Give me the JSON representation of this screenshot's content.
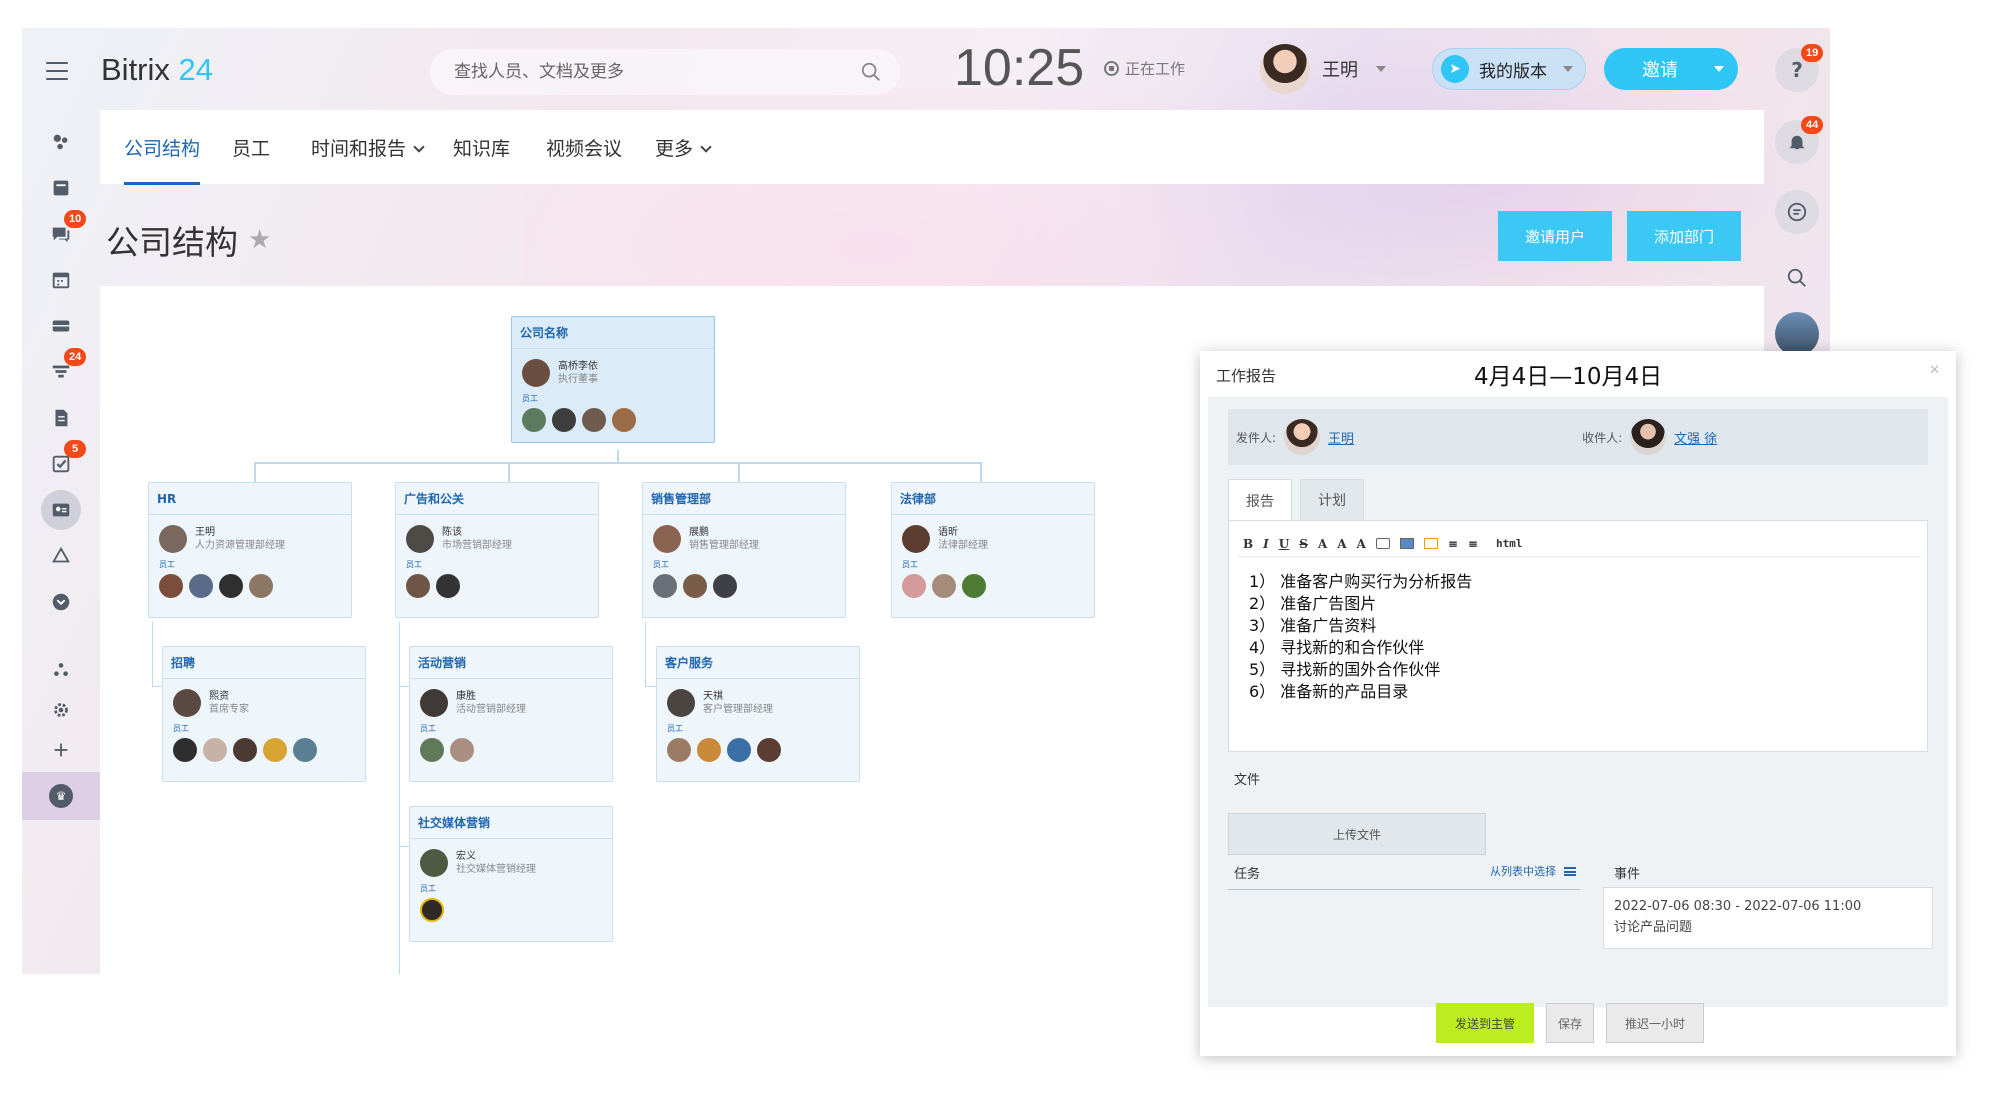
{
  "app": {
    "logo_text": "Bitrix",
    "logo_num": "24",
    "clock": "10:25",
    "work_status": "正在工作"
  },
  "search": {
    "placeholder": "查找人员、文档及更多"
  },
  "user": {
    "name": "王明"
  },
  "header": {
    "my_version": "我的版本",
    "invite": "邀请"
  },
  "right_bar": {
    "help_count": "19",
    "notify_count": "44"
  },
  "left_bar": {
    "chat_count": "10",
    "feed_count": "24",
    "tasks_count": "5"
  },
  "tabs": [
    {
      "label": "公司结构"
    },
    {
      "label": "员工"
    },
    {
      "label": "时间和报告"
    },
    {
      "label": "知识库"
    },
    {
      "label": "视频会议"
    },
    {
      "label": "更多"
    }
  ],
  "page": {
    "title": "公司结构",
    "invite_users": "邀请用户",
    "add_department": "添加部门"
  },
  "accent": "#2fc6f6",
  "org": {
    "employees_label": "员工",
    "root": {
      "name": "公司名称",
      "manager": "高桥李依",
      "title": "执行董事"
    },
    "departments": [
      {
        "name": "HR",
        "manager": "王明",
        "title": "人力资源管理部经理"
      },
      {
        "name": "广告和公关",
        "manager": "陈该",
        "title": "市场营销部经理"
      },
      {
        "name": "销售管理部",
        "manager": "展鹏",
        "title": "销售管理部经理"
      },
      {
        "name": "法律部",
        "manager": "语昕",
        "title": "法律部经理"
      },
      {
        "name": "招聘",
        "manager": "熙资",
        "title": "首席专家"
      },
      {
        "name": "活动营销",
        "manager": "康胜",
        "title": "活动营销部经理"
      },
      {
        "name": "客户服务",
        "manager": "天祺",
        "title": "客户管理部经理"
      },
      {
        "name": "社交媒体营销",
        "manager": "宏义",
        "title": "社交媒体营销经理"
      }
    ]
  },
  "report": {
    "title": "工作报告",
    "date": "4月4日—10月4日",
    "sender_label": "发件人:",
    "sender": "王明",
    "recipient_label": "收件人:",
    "recipient": "文强 徐",
    "tab_report": "报告",
    "tab_plan": "计划",
    "html_label": "html",
    "items": [
      "1） 准备客户购买行为分析报告",
      "2） 准备广告图片",
      "3） 准备广告资料",
      "4） 寻找新的和合作伙伴",
      "5） 寻找新的国外合作伙伴",
      "6） 准备新的产品目录"
    ],
    "files_label": "文件",
    "upload_label": "上传文件",
    "tasks_label": "任务",
    "pick_label": "从列表中选择",
    "events_label": "事件",
    "event_time": "2022-07-06 08:30 - 2022-07-06 11:00",
    "event_title": "讨论产品问题",
    "send": "发送到主管",
    "save": "保存",
    "delay": "推迟一小时"
  }
}
